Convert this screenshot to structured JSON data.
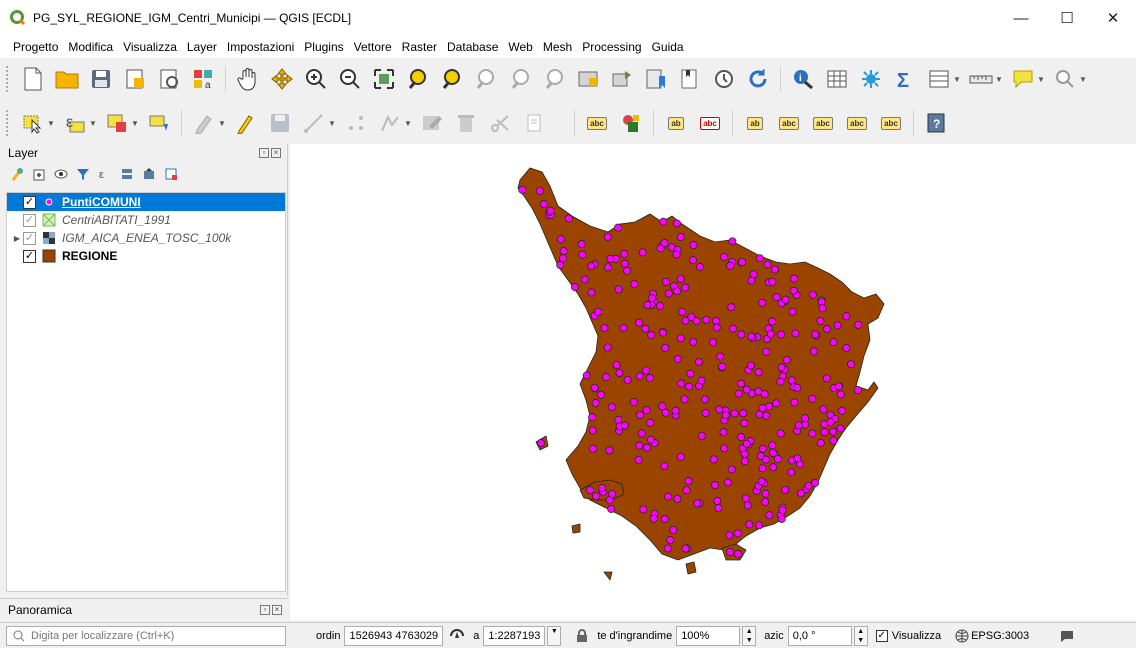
{
  "window": {
    "title": "PG_SYL_REGIONE_IGM_Centri_Municipi — QGIS [ECDL]",
    "minimize": "—",
    "maximize": "☐",
    "close": "✕"
  },
  "menu": [
    "Progetto",
    "Modifica",
    "Visualizza",
    "Layer",
    "Impostazioni",
    "Plugins",
    "Vettore",
    "Raster",
    "Database",
    "Web",
    "Mesh",
    "Processing",
    "Guida"
  ],
  "layers_panel": {
    "title": "Layer",
    "items": [
      {
        "name": "PuntiCOMUNI",
        "checked": "✓"
      },
      {
        "name": "CentriABITATI_1991",
        "checked": "✓"
      },
      {
        "name": "IGM_AICA_ENEA_TOSC_100k",
        "checked": "✓"
      },
      {
        "name": "REGIONE",
        "checked": "✓"
      }
    ]
  },
  "overview_panel": {
    "title": "Panoramica"
  },
  "labels_toolbar": {
    "abc": "abc",
    "ab": "ab"
  },
  "statusbar": {
    "search_placeholder": "Digita per localizzare (Ctrl+K)",
    "coord_label": "ordin",
    "coord_value": "1526943 4763029",
    "scale_label": "a",
    "scale_value": "1:2287193",
    "magnifier_label": "te d'ingrandime",
    "magnifier_value": "100%",
    "rotation_label": "azic",
    "rotation_value": "0,0 °",
    "render_check": "✓",
    "render_label": "Visualizza",
    "crs": "EPSG:3003"
  },
  "colors": {
    "region_fill": "#9a4400",
    "point_fill": "#ff00ff",
    "selection": "#0078d7"
  }
}
